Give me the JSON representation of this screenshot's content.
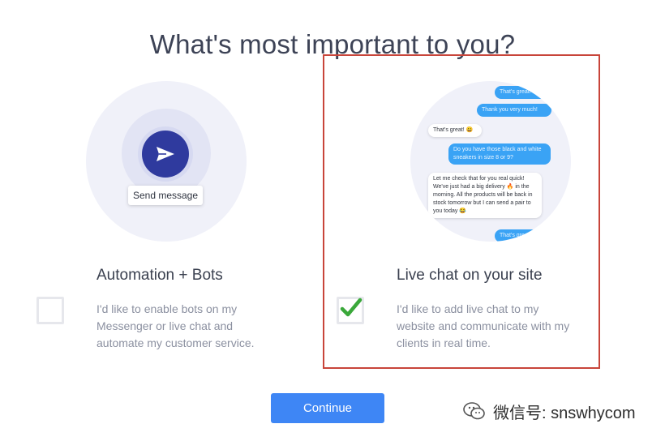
{
  "header": {
    "title": "What's most important to you?"
  },
  "options": [
    {
      "title": "Automation + Bots",
      "description_lines": [
        "I'd like to enable bots on my",
        "Messenger or live chat and",
        "automate my customer service."
      ],
      "checked": false,
      "illustration": {
        "send_label": "Send message"
      }
    },
    {
      "title": "Live chat on your site",
      "description_lines": [
        "I'd like to add live chat to my",
        "website and communicate with my",
        "clients in real time."
      ],
      "checked": true,
      "illustration": {
        "messages": [
          {
            "from": "agent",
            "text": "That's great!"
          },
          {
            "from": "visitor",
            "text": "Thank you very much!"
          },
          {
            "from": "agent",
            "text": "That's great! 😀"
          },
          {
            "from": "visitor",
            "text": "Do you have those black and white sneakers in size 8 or 9?"
          },
          {
            "from": "agent",
            "text": "Let me check that for you real quick! We've just had a big delivery 🔥 in the morning. All the products will be back in stock tomorrow but I can send a pair to you today 😂"
          },
          {
            "from": "visitor",
            "text": "That's great!"
          }
        ]
      }
    }
  ],
  "actions": {
    "continue_label": "Continue"
  },
  "watermark": {
    "text": "微信号: snswhycom"
  },
  "colors": {
    "accent": "#3e86f5",
    "highlight_border": "#c8453a",
    "check_green": "#3aa83a",
    "send_button": "#2f3a9e",
    "chat_blue": "#3aa3f5"
  }
}
